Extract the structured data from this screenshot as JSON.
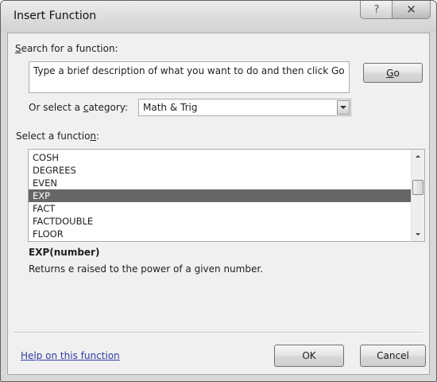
{
  "window": {
    "title": "Insert Function",
    "help_glyph": "?",
    "close_glyph": "✕"
  },
  "search": {
    "label_pre": "",
    "label_access": "S",
    "label_post": "earch for a function:",
    "text": "Type a brief description of what you want to do and then click Go",
    "go_access": "G",
    "go_rest": "o"
  },
  "category": {
    "label_pre": "Or select a ",
    "label_access": "c",
    "label_post": "ategory:",
    "value": "Math & Trig"
  },
  "functions": {
    "label_pre": "Select a functio",
    "label_access": "n",
    "label_post": ":",
    "items": [
      "COSH",
      "DEGREES",
      "EVEN",
      "EXP",
      "FACT",
      "FACTDOUBLE",
      "FLOOR"
    ],
    "selected_index": 3
  },
  "details": {
    "signature": "EXP(number)",
    "description": "Returns e raised to the power of a given number."
  },
  "footer": {
    "help_link": "Help on this function",
    "ok": "OK",
    "cancel": "Cancel"
  }
}
